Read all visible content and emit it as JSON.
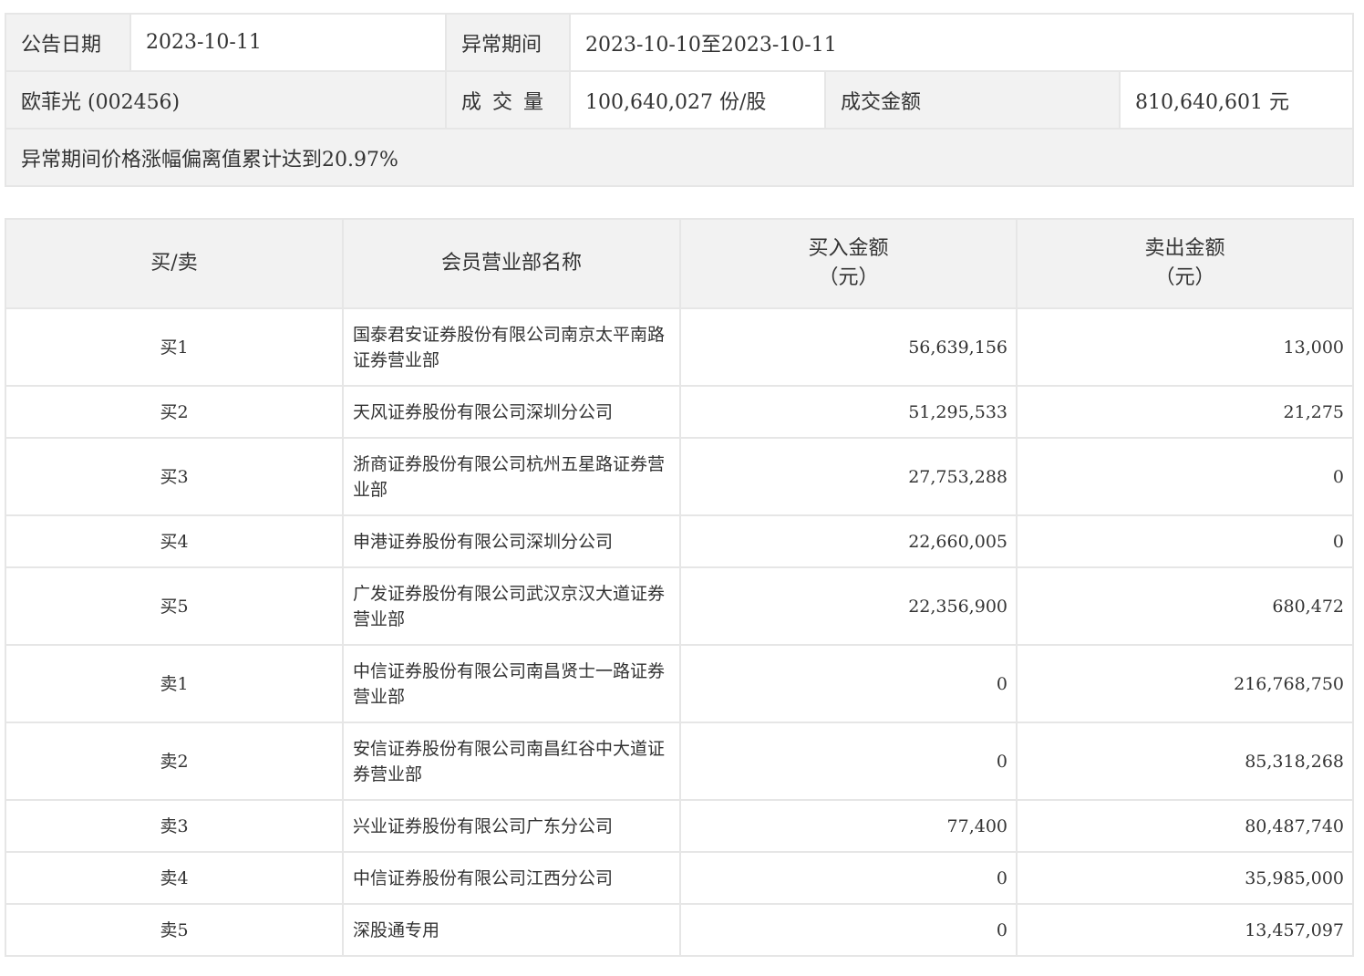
{
  "info": {
    "date_label": "公告日期",
    "date_value": "2023-10-11",
    "period_label": "异常期间",
    "period_value": "2023-10-10至2023-10-11",
    "stock_name": "欧菲光 (002456)",
    "volume_label": "成交量",
    "volume_value": "100,640,027 份/股",
    "amount_label": "成交金额",
    "amount_value": "810,640,601 元",
    "note": "异常期间价格涨幅偏离值累计达到20.97%"
  },
  "detail": {
    "headers": {
      "side": "买/卖",
      "member": "会员营业部名称",
      "buy": "买入金额",
      "buy_unit": "（元）",
      "sell": "卖出金额",
      "sell_unit": "（元）"
    },
    "rows": [
      {
        "side": "买1",
        "name": "国泰君安证券股份有限公司南京太平南路证券营业部",
        "buy": "56,639,156",
        "sell": "13,000"
      },
      {
        "side": "买2",
        "name": "天风证券股份有限公司深圳分公司",
        "buy": "51,295,533",
        "sell": "21,275"
      },
      {
        "side": "买3",
        "name": "浙商证券股份有限公司杭州五星路证券营业部",
        "buy": "27,753,288",
        "sell": "0"
      },
      {
        "side": "买4",
        "name": "申港证券股份有限公司深圳分公司",
        "buy": "22,660,005",
        "sell": "0"
      },
      {
        "side": "买5",
        "name": "广发证券股份有限公司武汉京汉大道证券营业部",
        "buy": "22,356,900",
        "sell": "680,472"
      },
      {
        "side": "卖1",
        "name": "中信证券股份有限公司南昌贤士一路证券营业部",
        "buy": "0",
        "sell": "216,768,750"
      },
      {
        "side": "卖2",
        "name": "安信证券股份有限公司南昌红谷中大道证券营业部",
        "buy": "0",
        "sell": "85,318,268"
      },
      {
        "side": "卖3",
        "name": "兴业证券股份有限公司广东分公司",
        "buy": "77,400",
        "sell": "80,487,740"
      },
      {
        "side": "卖4",
        "name": "中信证券股份有限公司江西分公司",
        "buy": "0",
        "sell": "35,985,000"
      },
      {
        "side": "卖5",
        "name": "深股通专用",
        "buy": "0",
        "sell": "13,457,097"
      }
    ]
  }
}
